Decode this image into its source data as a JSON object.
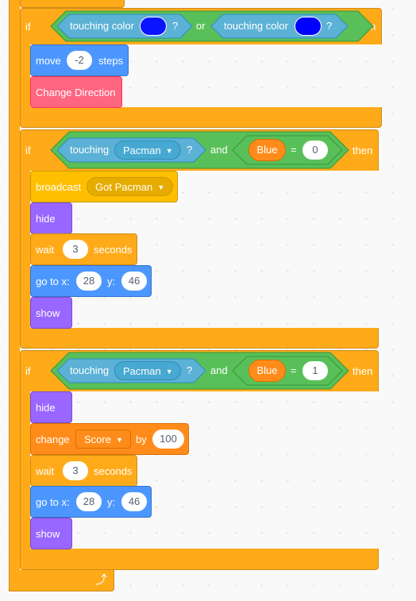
{
  "workspace": {
    "background": "#f9f9f9"
  },
  "colors": {
    "control": "#ffab19",
    "operators": "#59c059",
    "sensing": "#5cb1d6",
    "motion": "#4c97ff",
    "looks": "#9966ff",
    "events": "#ffbf00",
    "variables": "#ff8c1a",
    "custom": "#ff6680",
    "touch_color": "#0000ff"
  },
  "if1": {
    "keyword": "if",
    "then": "then",
    "cond_left": {
      "label": "touching color",
      "q": "?",
      "color": "#0a14ff"
    },
    "op": "or",
    "cond_right": {
      "label": "touching color",
      "q": "?",
      "color": "#0000ff"
    },
    "move": {
      "label": "move",
      "value": "-2",
      "suffix": "steps"
    },
    "custom_block": "Change Direction"
  },
  "if2": {
    "keyword": "if",
    "then": "then",
    "touching": {
      "label": "touching",
      "target": "Pacman",
      "q": "?"
    },
    "op": "and",
    "equals": {
      "variable": "Blue",
      "sign": "=",
      "value": "0"
    },
    "broadcast": {
      "label": "broadcast",
      "message": "Got Pacman"
    },
    "hide": "hide",
    "wait": {
      "label": "wait",
      "value": "3",
      "suffix": "seconds"
    },
    "goto": {
      "label": "go to x:",
      "x": "28",
      "ylabel": "y:",
      "y": "46"
    },
    "show": "show"
  },
  "if3": {
    "keyword": "if",
    "then": "then",
    "touching": {
      "label": "touching",
      "target": "Pacman",
      "q": "?"
    },
    "op": "and",
    "equals": {
      "variable": "Blue",
      "sign": "=",
      "value": "1"
    },
    "hide": "hide",
    "change": {
      "label": "change",
      "variable": "Score",
      "by": "by",
      "value": "100"
    },
    "wait": {
      "label": "wait",
      "value": "3",
      "suffix": "seconds"
    },
    "goto": {
      "label": "go to x:",
      "x": "28",
      "ylabel": "y:",
      "y": "46"
    },
    "show": "show"
  },
  "forever": {
    "loop_icon": "loop-arrow-icon",
    "arrow_glyph": "⤴"
  }
}
